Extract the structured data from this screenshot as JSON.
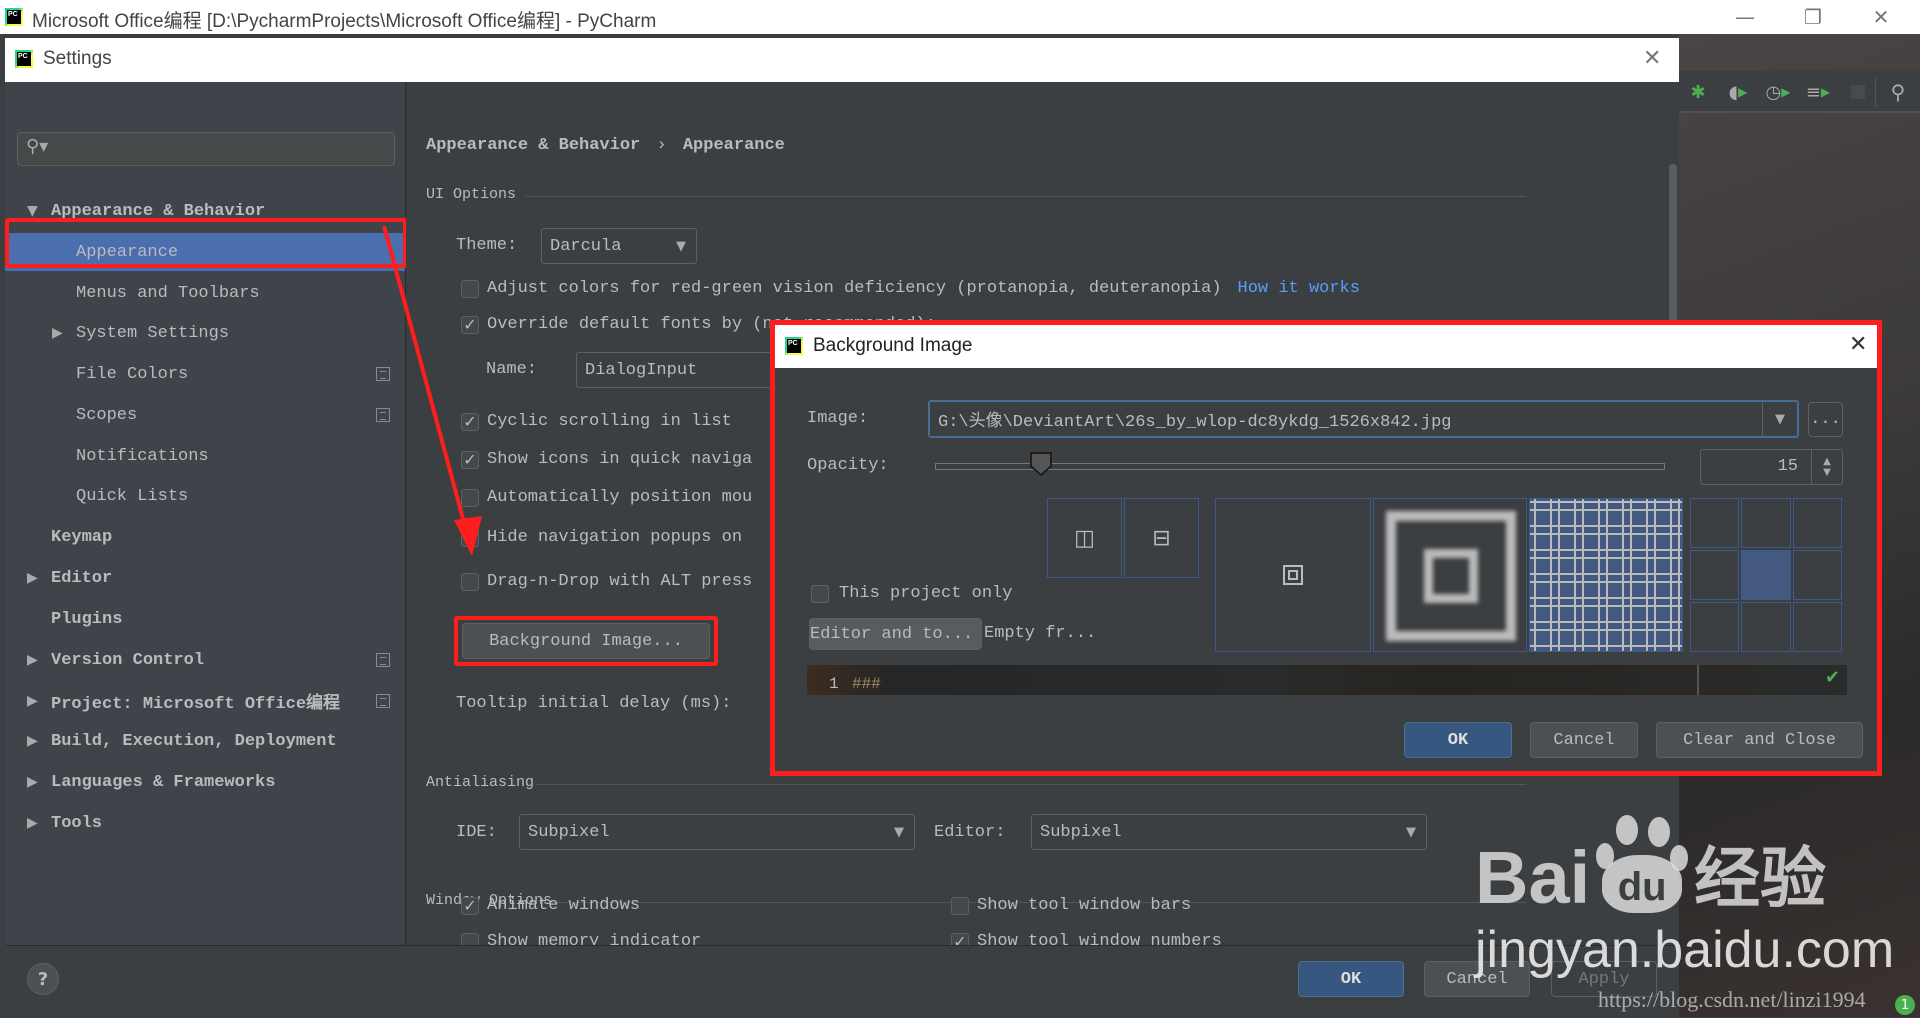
{
  "os_window": {
    "title": "Microsoft Office编程 [D:\\PycharmProjects\\Microsoft Office编程] - PyCharm",
    "controls": {
      "minimize": "—",
      "restore": "❐",
      "close": "✕"
    }
  },
  "ide_toolbar": {
    "icons": [
      "debug-icon",
      "run-with-coverage-icon",
      "profile-icon",
      "concurrency-diagram-icon",
      "stop-icon",
      "search-everywhere-icon"
    ]
  },
  "settings": {
    "title": "Settings",
    "close_glyph": "✕",
    "search": {
      "placeholder": "",
      "value": ""
    },
    "breadcrumb": {
      "parent": "Appearance & Behavior",
      "separator": "›",
      "current": "Appearance"
    },
    "sidebar": {
      "items": [
        {
          "label": "Appearance & Behavior",
          "level": 0,
          "expand": "▼",
          "bold": true
        },
        {
          "label": "Appearance",
          "level": 1,
          "selected": true
        },
        {
          "label": "Menus and Toolbars",
          "level": 1
        },
        {
          "label": "System Settings",
          "level": 1,
          "expand": "▶"
        },
        {
          "label": "File Colors",
          "level": 1,
          "project_icon": true
        },
        {
          "label": "Scopes",
          "level": 1,
          "project_icon": true
        },
        {
          "label": "Notifications",
          "level": 1
        },
        {
          "label": "Quick Lists",
          "level": 1
        },
        {
          "label": "Keymap",
          "level": 0,
          "bold": true
        },
        {
          "label": "Editor",
          "level": 0,
          "expand": "▶",
          "bold": true
        },
        {
          "label": "Plugins",
          "level": 0,
          "bold": true
        },
        {
          "label": "Version Control",
          "level": 0,
          "expand": "▶",
          "bold": true,
          "project_icon": true
        },
        {
          "label": "Project: Microsoft Office编程",
          "level": 0,
          "expand": "▶",
          "bold": true,
          "project_icon": true
        },
        {
          "label": "Build, Execution, Deployment",
          "level": 0,
          "expand": "▶",
          "bold": true
        },
        {
          "label": "Languages & Frameworks",
          "level": 0,
          "expand": "▶",
          "bold": true
        },
        {
          "label": "Tools",
          "level": 0,
          "expand": "▶",
          "bold": true
        }
      ]
    },
    "ui_options": {
      "section_title": "UI Options",
      "theme_label": "Theme:",
      "theme_value": "Darcula",
      "adjust_colors": {
        "label": "Adjust colors for red-green vision deficiency (protanopia, deuteranopia)",
        "checked": false,
        "link": "How it works"
      },
      "override_fonts": {
        "label": "Override default fonts by (not recommended):",
        "checked": true
      },
      "font_name_label": "Name:",
      "font_name_value": "DialogInput",
      "checkboxes": [
        {
          "label": "Cyclic scrolling in list",
          "checked": true
        },
        {
          "label": "Show icons in quick naviga",
          "checked": true
        },
        {
          "label": "Automatically position mou",
          "checked": false
        },
        {
          "label": "Hide navigation popups on",
          "checked": true
        },
        {
          "label": "Drag-n-Drop with ALT press",
          "checked": false
        }
      ],
      "background_image_button": "Background Image...",
      "tooltip_delay_label": "Tooltip initial delay (ms):"
    },
    "antialiasing": {
      "section_title": "Antialiasing",
      "ide_label": "IDE:",
      "ide_value": "Subpixel",
      "editor_label": "Editor:",
      "editor_value": "Subpixel"
    },
    "window_options": {
      "section_title": "Window Options",
      "checkboxes": [
        {
          "label": "Animate windows",
          "checked": true
        },
        {
          "label": "Show tool window bars",
          "checked": false
        },
        {
          "label": "Show memory indicator",
          "checked": false
        },
        {
          "label": "Show tool window numbers",
          "checked": true
        }
      ]
    },
    "footer": {
      "help": "?",
      "ok": "OK",
      "cancel": "Cancel",
      "apply": "Apply"
    }
  },
  "background_image_dialog": {
    "title": "Background Image",
    "close_glyph": "✕",
    "image_label": "Image:",
    "image_path": "G:\\头像\\DeviantArt\\26s_by_wlop-dc8ykdg_1526x842.jpg",
    "browse_button": "...",
    "opacity_label": "Opacity:",
    "opacity_value": "15",
    "opacity_fraction": 0.15,
    "flip_buttons": [
      "flip-horizontal-icon",
      "flip-vertical-icon"
    ],
    "fill_options": [
      "center",
      "scale",
      "tile"
    ],
    "selected_fill": "tile",
    "anchor_selected": "center",
    "this_project_only": {
      "label": "This project only",
      "checked": false
    },
    "target_button": "Editor and to...",
    "target_text": "Empty fr...",
    "preview": {
      "line_number": "1",
      "code": "###"
    },
    "ok": "OK",
    "cancel": "Cancel",
    "clear_and_close": "Clear and Close"
  },
  "watermarks": {
    "baidu_brand": "Bai",
    "baidu_du": "du",
    "baidu_cn": "经验",
    "baidu_url": "jingyan.baidu.com",
    "csdn_url": "https://blog.csdn.net/linzi1994"
  },
  "annotation_color": "#ff1e1e",
  "accent_color": "#4b6eaf"
}
